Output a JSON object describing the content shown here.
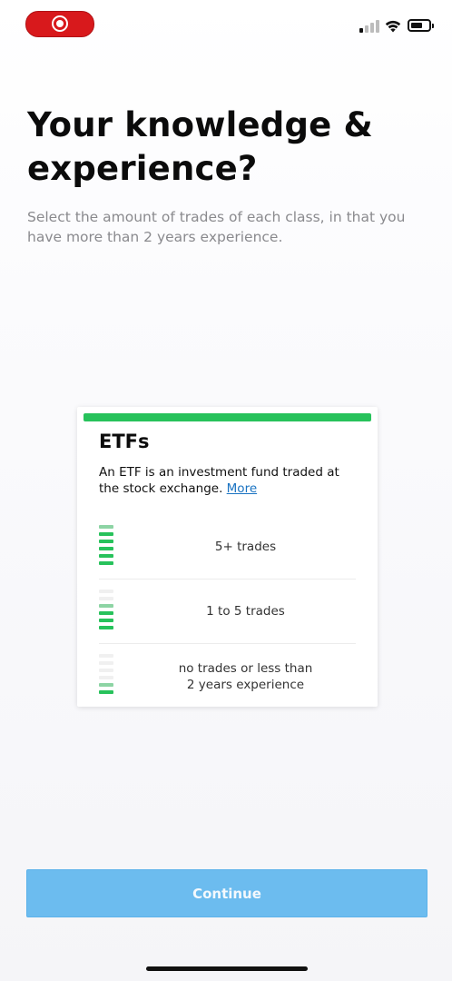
{
  "status_bar": {
    "record_icon": "screen-recording-icon",
    "signal_icon": "cellular-signal-icon",
    "wifi_icon": "wifi-icon",
    "battery_icon": "battery-icon",
    "battery_level": 0.55,
    "signal_bars_active": 1,
    "signal_bars_total": 4
  },
  "page": {
    "title": "Your knowledge &\nexperience?",
    "subtitle": "Select the amount of trades of each class, in that you have more than 2 years experience."
  },
  "card": {
    "accent_color": "#27c25b",
    "title": "ETFs",
    "description": "An ETF is an investment fund traded at the stock exchange.",
    "more_link": "More",
    "options": [
      {
        "label": "5+ trades",
        "level": 6,
        "max": 6
      },
      {
        "label": "1 to 5 trades",
        "level": 4,
        "max": 6
      },
      {
        "label": "no trades or less than 2 years experience",
        "line1": "no trades or less than",
        "line2": "2 years experience",
        "level": 2,
        "max": 6
      }
    ]
  },
  "footer": {
    "continue_label": "Continue",
    "continue_color": "#6cbcef"
  }
}
